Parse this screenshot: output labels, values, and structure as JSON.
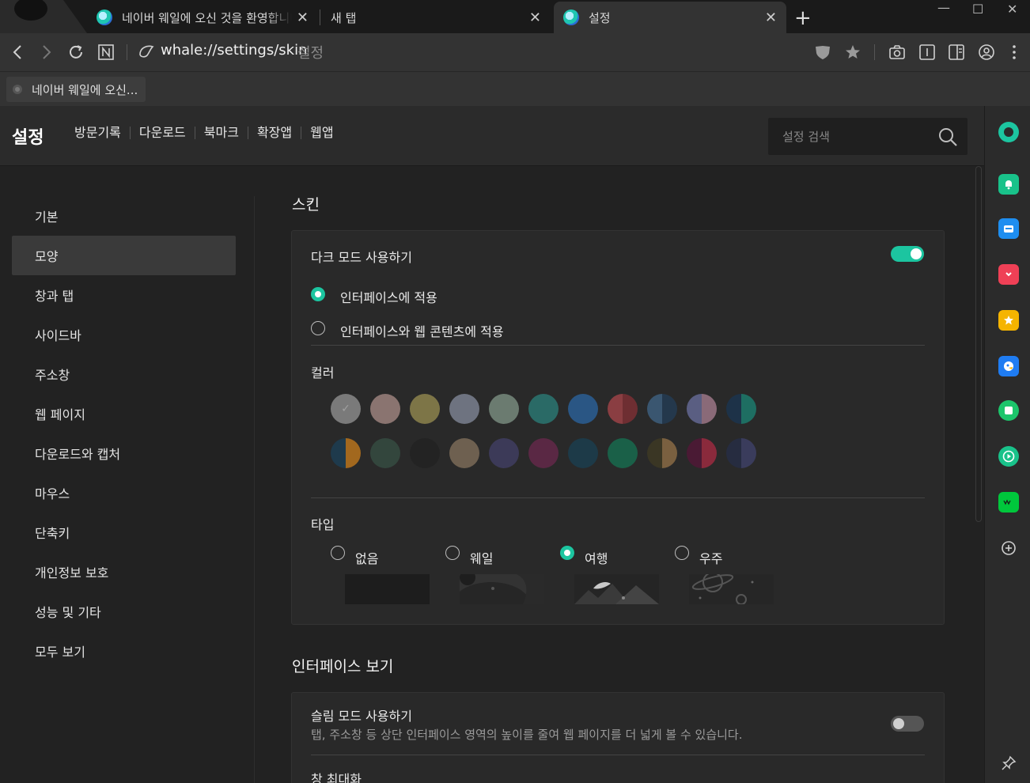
{
  "browser": {
    "tabs": [
      {
        "title": "네이버 웨일에 오신 것을 환영합니다",
        "active": false
      },
      {
        "title": "새 탭",
        "active": false
      },
      {
        "title": "설정",
        "active": true
      }
    ],
    "new_tab_symbol": "+",
    "close_symbol": "✕",
    "window_controls": {
      "minimize": "—",
      "maximize": "☐",
      "close": "✕"
    },
    "url": "whale://settings/skin",
    "url_hint": "설정",
    "bookmark": {
      "label": "네이버 웨일에 오신..."
    }
  },
  "settings": {
    "title": "설정",
    "nav_links": [
      "방문기록",
      "다운로드",
      "북마크",
      "확장앱",
      "웹앱"
    ],
    "search_placeholder": "설정 검색",
    "left_nav": [
      {
        "label": "기본",
        "active": false
      },
      {
        "label": "모양",
        "active": true
      },
      {
        "label": "창과 탭",
        "active": false
      },
      {
        "label": "사이드바",
        "active": false
      },
      {
        "label": "주소창",
        "active": false
      },
      {
        "label": "웹 페이지",
        "active": false
      },
      {
        "label": "다운로드와 캡처",
        "active": false
      },
      {
        "label": "마우스",
        "active": false
      },
      {
        "label": "단축키",
        "active": false
      },
      {
        "label": "개인정보 보호",
        "active": false
      },
      {
        "label": "성능 및 기타",
        "active": false
      },
      {
        "label": "모두 보기",
        "active": false
      }
    ],
    "skin": {
      "section_title": "스킨",
      "dark_mode_label": "다크 모드 사용하기",
      "dark_mode_on": true,
      "dark_mode_options": [
        {
          "label": "인터페이스에 적용",
          "checked": true
        },
        {
          "label": "인터페이스와 웹 콘텐츠에 적용",
          "checked": false
        }
      ],
      "color_label": "컬러",
      "colors_row1": [
        [
          "#7a7a7a",
          "#7a7a7a"
        ],
        [
          "#8a7470",
          "#8a7470"
        ],
        [
          "#7d7547",
          "#7d7547"
        ],
        [
          "#6e7380",
          "#6e7380"
        ],
        [
          "#6b7b70",
          "#6b7b70"
        ],
        [
          "#2a6a66",
          "#2a6a66"
        ],
        [
          "#2a5684",
          "#2a5684"
        ],
        [
          "#8a3e42",
          "#6e2e32"
        ],
        [
          "#3a5670",
          "#24384c"
        ],
        [
          "#5a5e82",
          "#8a6a78"
        ],
        [
          "#1d3248",
          "#1e6e62"
        ]
      ],
      "colors_row2": [
        [
          "#1e3a4c",
          "#a2681e"
        ],
        [
          "#33463d",
          "#33463d"
        ],
        [
          "#232323",
          "#232323"
        ],
        [
          "#6e6050",
          "#6e6050"
        ],
        [
          "#3c3a58",
          "#3c3a58"
        ],
        [
          "#5a2844",
          "#5a2844"
        ],
        [
          "#1d3a48",
          "#1d3a48"
        ],
        [
          "#1a6048",
          "#1a6048"
        ],
        [
          "#3a3624",
          "#7a6040"
        ],
        [
          "#4a1a34",
          "#8a2a3c"
        ],
        [
          "#262c40",
          "#3a3c5c"
        ]
      ],
      "selected_color_index": 0,
      "type_label": "타입",
      "type_options": [
        {
          "label": "없음",
          "checked": false
        },
        {
          "label": "웨일",
          "checked": false
        },
        {
          "label": "여행",
          "checked": true
        },
        {
          "label": "우주",
          "checked": false
        }
      ]
    },
    "interface": {
      "section_title": "인터페이스 보기",
      "slim_label": "슬림 모드 사용하기",
      "slim_desc": "탭, 주소창 등 상단 인터페이스 영역의 높이를 줄여 웹 페이지를 더 넓게 볼 수 있습니다.",
      "slim_on": false,
      "maximize_label": "창 최대화"
    }
  }
}
